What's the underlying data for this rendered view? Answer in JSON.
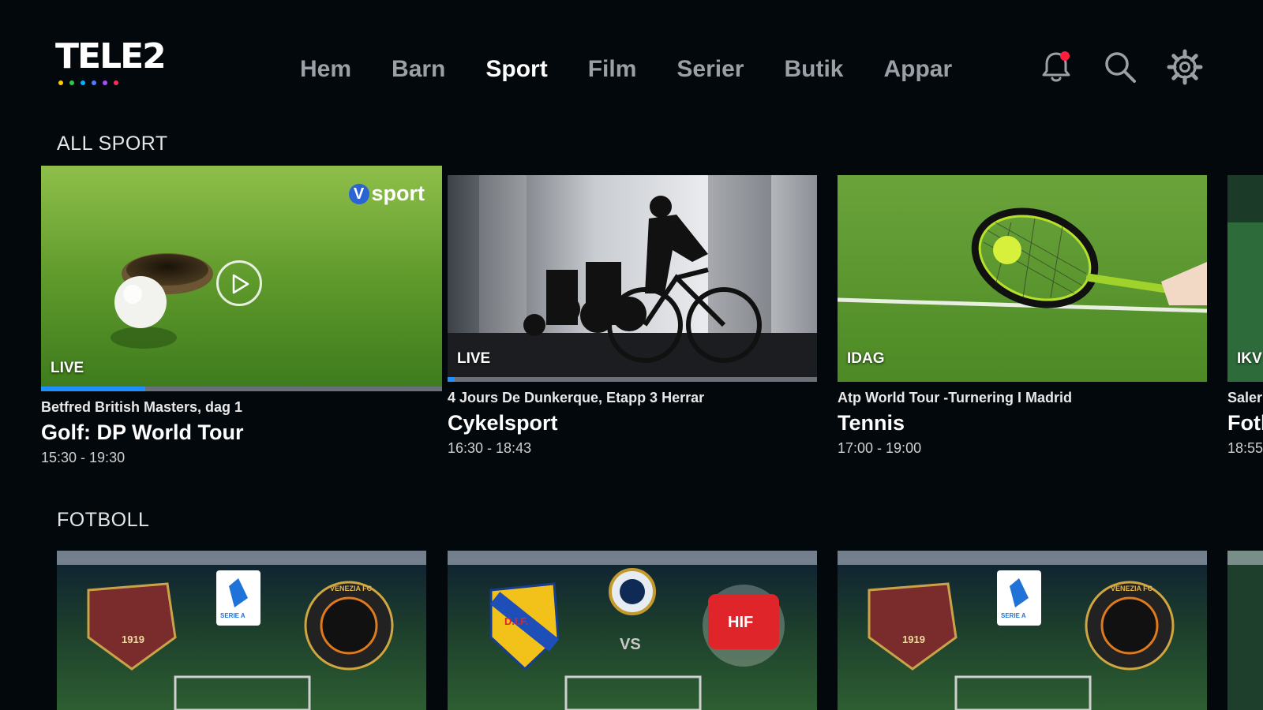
{
  "brand": {
    "logo_text": "TELE2",
    "dot_colors": [
      "#ffcc00",
      "#2ecc40",
      "#00b2ff",
      "#4d7cff",
      "#a64dff",
      "#ff2d55"
    ]
  },
  "nav": {
    "items": [
      {
        "label": "Hem",
        "active": false
      },
      {
        "label": "Barn",
        "active": false
      },
      {
        "label": "Sport",
        "active": true
      },
      {
        "label": "Film",
        "active": false
      },
      {
        "label": "Serier",
        "active": false
      },
      {
        "label": "Butik",
        "active": false
      },
      {
        "label": "Appar",
        "active": false
      }
    ],
    "icons": [
      "bell-icon",
      "search-icon",
      "gear-icon"
    ],
    "notification_dot_color": "#ff1f3d"
  },
  "sections": {
    "all_sport": {
      "title": "ALL SPORT",
      "cards": [
        {
          "badge": "LIVE",
          "subtitle": "Betfred British Masters, dag 1",
          "title": "Golf: DP World Tour",
          "time": "15:30 - 19:30",
          "progress": 0.26,
          "channel_mark": "V",
          "channel_name": "sport"
        },
        {
          "badge": "LIVE",
          "subtitle": "4 Jours De Dunkerque, Etapp 3 Herrar",
          "title": "Cykelsport",
          "time": "16:30 - 18:43",
          "progress": 0.02
        },
        {
          "badge": "IDAG",
          "subtitle": "Atp World Tour -Turnering I Madrid",
          "title": "Tennis",
          "time": "17:00 - 19:00"
        },
        {
          "badge": "IKV",
          "subtitle": "Saler",
          "title": "Fotl",
          "time": "18:55"
        }
      ]
    },
    "fotboll": {
      "title": "FOTBOLL",
      "cards": [
        {
          "home_badge": "1919",
          "league_label": "SERIE A",
          "away_badge": "VENEZIA FC"
        },
        {
          "home_badge": "D.I.F.",
          "league_label": "VS",
          "away_badge": "HIF"
        },
        {
          "home_badge": "1919",
          "league_label": "SERIE A",
          "away_badge": "VENEZIA FC"
        }
      ]
    }
  },
  "colors": {
    "background": "#03080c",
    "accent": "#1e90ff",
    "nav_inactive": "#9aa0a6"
  }
}
